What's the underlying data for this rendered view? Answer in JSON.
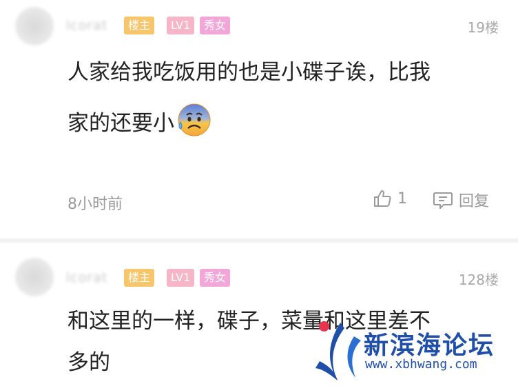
{
  "comments": [
    {
      "username": "lcorat",
      "badges": [
        "楼主",
        "LV1",
        "秀女"
      ],
      "floor": "19楼",
      "lines": [
        "人家给我吃饭用的也是小碟子诶，比我",
        "家的还要小"
      ],
      "emoji": "anxious-sweat-face-icon",
      "time": "8小时前",
      "like_count": "1",
      "reply_label": "回复"
    },
    {
      "username": "lcorat",
      "badges": [
        "楼主",
        "LV1",
        "秀女"
      ],
      "floor": "128楼",
      "lines": [
        "和这里的一样，碟子，菜量和这里差不",
        "多的"
      ]
    }
  ],
  "watermark": {
    "name": "新滨海论坛",
    "url": "www.xbhwang.com"
  },
  "colors": {
    "badge_host": "#f7c56a",
    "badge_lv": "#f7b6c8",
    "badge_show": "#f3a6d8",
    "watermark_blue": "#1f4fa8",
    "watermark_red": "#e8344e"
  }
}
